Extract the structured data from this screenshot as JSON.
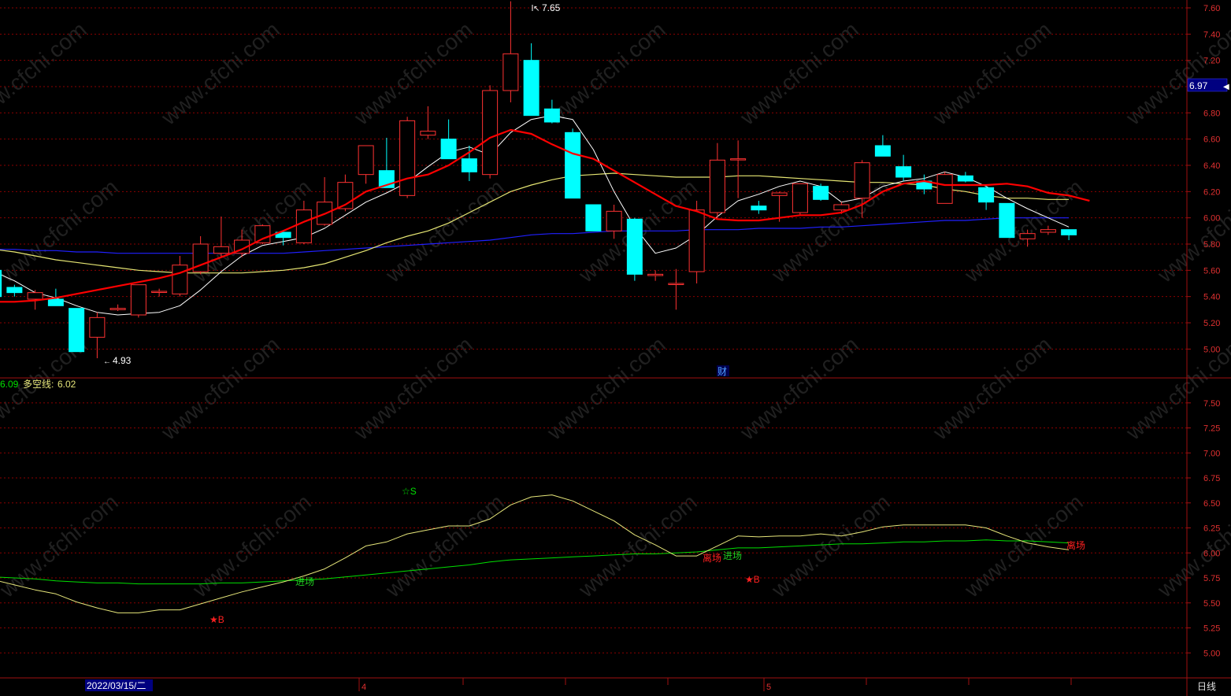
{
  "colors": {
    "background": "#000000",
    "grid": "#8b0000",
    "frame": "#a01010",
    "up": "#ff3232",
    "down": "#00ffff",
    "ma_white": "#ffffff",
    "ma_red": "#ff0000",
    "ma_yellow": "#e6e673",
    "ma_blue": "#2020ff",
    "short_line": "#e6e67a",
    "long_line": "#00e000",
    "axis_text": "#e03030",
    "price_badge_bg": "#000080"
  },
  "top_panel": {
    "y_ticks": [
      "7.60",
      "7.40",
      "7.20",
      "6.80",
      "6.60",
      "6.40",
      "6.20",
      "6.00",
      "5.80",
      "5.60",
      "5.40",
      "5.20",
      "5.00"
    ],
    "current_price": "6.97",
    "high_annotation": "7.65",
    "low_annotation": "4.93",
    "finance_marker": "财"
  },
  "bottom_panel": {
    "header_value1": "6.09",
    "header_label2": "多空线:",
    "header_value2": "6.02",
    "y_ticks": [
      "7.50",
      "7.25",
      "7.00",
      "6.75",
      "6.50",
      "6.25",
      "6.00",
      "5.75",
      "5.50",
      "5.25",
      "5.00"
    ],
    "signals": {
      "sell_star": "☆S",
      "buy_star_1": "★B",
      "buy_star_2": "★B",
      "enter_1": "进场",
      "enter_2": "进场",
      "exit_1": "离场",
      "exit_2": "离场"
    }
  },
  "x_axis": {
    "date_label": "2022/03/15/二",
    "month_4": "4",
    "month_5": "5",
    "period_label": "日线"
  },
  "watermark": "www.cfchi.com",
  "chart_data": {
    "type": "candlestick",
    "top_ylim": [
      4.78,
      7.66
    ],
    "bottom_ylim": [
      4.75,
      7.75
    ],
    "candles": [
      {
        "o": 5.6,
        "h": 5.62,
        "l": 5.4,
        "c": 5.4
      },
      {
        "o": 5.47,
        "h": 5.49,
        "l": 5.4,
        "c": 5.43
      },
      {
        "o": 5.38,
        "h": 5.45,
        "l": 5.3,
        "c": 5.43
      },
      {
        "o": 5.38,
        "h": 5.46,
        "l": 5.33,
        "c": 5.33
      },
      {
        "o": 5.31,
        "h": 5.31,
        "l": 4.98,
        "c": 4.98
      },
      {
        "o": 5.09,
        "h": 5.28,
        "l": 4.93,
        "c": 5.24
      },
      {
        "o": 5.3,
        "h": 5.34,
        "l": 5.29,
        "c": 5.31
      },
      {
        "o": 5.26,
        "h": 5.49,
        "l": 5.24,
        "c": 5.49
      },
      {
        "o": 5.44,
        "h": 5.46,
        "l": 5.4,
        "c": 5.44
      },
      {
        "o": 5.42,
        "h": 5.71,
        "l": 5.4,
        "c": 5.64
      },
      {
        "o": 5.59,
        "h": 5.86,
        "l": 5.57,
        "c": 5.8
      },
      {
        "o": 5.73,
        "h": 6.01,
        "l": 5.7,
        "c": 5.78
      },
      {
        "o": 5.73,
        "h": 5.91,
        "l": 5.7,
        "c": 5.83
      },
      {
        "o": 5.81,
        "h": 5.95,
        "l": 5.8,
        "c": 5.94
      },
      {
        "o": 5.89,
        "h": 5.89,
        "l": 5.79,
        "c": 5.85
      },
      {
        "o": 5.81,
        "h": 6.13,
        "l": 5.8,
        "c": 6.06
      },
      {
        "o": 5.95,
        "h": 6.31,
        "l": 5.94,
        "c": 6.12
      },
      {
        "o": 6.07,
        "h": 6.33,
        "l": 6.05,
        "c": 6.27
      },
      {
        "o": 6.33,
        "h": 6.55,
        "l": 6.26,
        "c": 6.55
      },
      {
        "o": 6.36,
        "h": 6.61,
        "l": 6.23,
        "c": 6.23
      },
      {
        "o": 6.17,
        "h": 6.77,
        "l": 6.15,
        "c": 6.74
      },
      {
        "o": 6.63,
        "h": 6.85,
        "l": 6.6,
        "c": 6.66
      },
      {
        "o": 6.6,
        "h": 6.75,
        "l": 6.45,
        "c": 6.45
      },
      {
        "o": 6.45,
        "h": 6.55,
        "l": 6.28,
        "c": 6.35
      },
      {
        "o": 6.33,
        "h": 7.01,
        "l": 6.3,
        "c": 6.97
      },
      {
        "o": 6.97,
        "h": 7.65,
        "l": 6.88,
        "c": 7.25
      },
      {
        "o": 7.2,
        "h": 7.33,
        "l": 6.78,
        "c": 6.78
      },
      {
        "o": 6.83,
        "h": 6.9,
        "l": 6.72,
        "c": 6.73
      },
      {
        "o": 6.65,
        "h": 6.68,
        "l": 6.45,
        "c": 6.15
      },
      {
        "o": 6.1,
        "h": 6.1,
        "l": 5.9,
        "c": 5.9
      },
      {
        "o": 5.9,
        "h": 6.1,
        "l": 5.84,
        "c": 6.05
      },
      {
        "o": 5.99,
        "h": 6.0,
        "l": 5.52,
        "c": 5.57
      },
      {
        "o": 5.56,
        "h": 5.6,
        "l": 5.52,
        "c": 5.57
      },
      {
        "o": 5.5,
        "h": 5.61,
        "l": 5.3,
        "c": 5.5
      },
      {
        "o": 5.59,
        "h": 6.13,
        "l": 5.5,
        "c": 6.06
      },
      {
        "o": 6.04,
        "h": 6.57,
        "l": 6.0,
        "c": 6.44
      },
      {
        "o": 6.45,
        "h": 6.59,
        "l": 6.15,
        "c": 6.45
      },
      {
        "o": 6.09,
        "h": 6.13,
        "l": 6.03,
        "c": 6.06
      },
      {
        "o": 6.17,
        "h": 6.2,
        "l": 5.97,
        "c": 6.19
      },
      {
        "o": 6.04,
        "h": 6.26,
        "l": 6.02,
        "c": 6.26
      },
      {
        "o": 6.24,
        "h": 6.26,
        "l": 6.13,
        "c": 6.14
      },
      {
        "o": 6.06,
        "h": 6.12,
        "l": 6.03,
        "c": 6.1
      },
      {
        "o": 6.15,
        "h": 6.44,
        "l": 6.0,
        "c": 6.42
      },
      {
        "o": 6.55,
        "h": 6.63,
        "l": 6.48,
        "c": 6.47
      },
      {
        "o": 6.39,
        "h": 6.48,
        "l": 6.28,
        "c": 6.31
      },
      {
        "o": 6.28,
        "h": 6.33,
        "l": 6.18,
        "c": 6.22
      },
      {
        "o": 6.11,
        "h": 6.35,
        "l": 6.11,
        "c": 6.33
      },
      {
        "o": 6.32,
        "h": 6.35,
        "l": 6.27,
        "c": 6.28
      },
      {
        "o": 6.23,
        "h": 6.25,
        "l": 6.06,
        "c": 6.12
      },
      {
        "o": 6.11,
        "h": 6.11,
        "l": 5.85,
        "c": 5.85
      },
      {
        "o": 5.84,
        "h": 5.91,
        "l": 5.78,
        "c": 5.88
      },
      {
        "o": 5.89,
        "h": 5.94,
        "l": 5.87,
        "c": 5.91
      },
      {
        "o": 5.91,
        "h": 5.91,
        "l": 5.83,
        "c": 5.87
      }
    ],
    "ma_white": [
      5.59,
      5.52,
      5.43,
      5.39,
      5.33,
      5.28,
      5.26,
      5.27,
      5.28,
      5.33,
      5.45,
      5.59,
      5.71,
      5.79,
      5.82,
      5.85,
      5.92,
      6.02,
      6.12,
      6.19,
      6.27,
      6.39,
      6.5,
      6.54,
      6.48,
      6.65,
      6.75,
      6.78,
      6.75,
      6.52,
      6.2,
      5.93,
      5.73,
      5.77,
      5.87,
      6.01,
      6.13,
      6.18,
      6.24,
      6.28,
      6.24,
      6.12,
      6.15,
      6.24,
      6.28,
      6.3,
      6.35,
      6.31,
      6.24,
      6.15,
      6.07,
      6.0,
      5.93
    ],
    "ma_red": [
      5.59,
      5.55,
      5.51,
      5.47,
      5.42,
      5.38,
      5.36,
      5.36,
      5.37,
      5.39,
      5.42,
      5.45,
      5.48,
      5.51,
      5.54,
      5.58,
      5.64,
      5.7,
      5.76,
      5.84,
      5.9,
      5.97,
      6.03,
      6.1,
      6.2,
      6.25,
      6.3,
      6.33,
      6.4,
      6.5,
      6.61,
      6.67,
      6.64,
      6.56,
      6.49,
      6.45,
      6.36,
      6.27,
      6.18,
      6.09,
      6.05,
      5.99,
      5.98,
      5.98,
      6.0,
      6.02,
      6.02,
      6.04,
      6.1,
      6.2,
      6.26,
      6.28,
      6.25,
      6.25,
      6.25,
      6.26,
      6.24,
      6.19,
      6.17,
      6.13
    ],
    "ma_yellow": [
      5.76,
      5.74,
      5.71,
      5.68,
      5.66,
      5.64,
      5.62,
      5.6,
      5.59,
      5.58,
      5.58,
      5.58,
      5.58,
      5.59,
      5.6,
      5.62,
      5.65,
      5.7,
      5.75,
      5.81,
      5.86,
      5.9,
      5.96,
      6.04,
      6.12,
      6.2,
      6.25,
      6.29,
      6.32,
      6.33,
      6.34,
      6.33,
      6.32,
      6.31,
      6.31,
      6.31,
      6.32,
      6.32,
      6.31,
      6.3,
      6.29,
      6.28,
      6.27,
      6.27,
      6.26,
      6.25,
      6.22,
      6.2,
      6.17,
      6.15,
      6.15,
      6.14,
      6.14
    ],
    "ma_blue": [
      5.76,
      5.76,
      5.75,
      5.75,
      5.74,
      5.74,
      5.73,
      5.73,
      5.73,
      5.73,
      5.73,
      5.73,
      5.73,
      5.73,
      5.73,
      5.74,
      5.75,
      5.76,
      5.77,
      5.78,
      5.79,
      5.8,
      5.81,
      5.82,
      5.83,
      5.85,
      5.87,
      5.88,
      5.88,
      5.89,
      5.9,
      5.9,
      5.9,
      5.9,
      5.91,
      5.91,
      5.91,
      5.92,
      5.92,
      5.92,
      5.93,
      5.93,
      5.94,
      5.95,
      5.96,
      5.97,
      5.98,
      5.98,
      5.99,
      6.0,
      6.0,
      6.0,
      6.0
    ],
    "short_line": [
      5.73,
      5.68,
      5.63,
      5.59,
      5.51,
      5.45,
      5.4,
      5.4,
      5.43,
      5.43,
      5.49,
      5.55,
      5.61,
      5.66,
      5.71,
      5.77,
      5.84,
      5.95,
      6.07,
      6.11,
      6.19,
      6.23,
      6.27,
      6.27,
      6.34,
      6.48,
      6.56,
      6.58,
      6.52,
      6.42,
      6.32,
      6.18,
      6.08,
      5.97,
      5.97,
      6.07,
      6.17,
      6.16,
      6.17,
      6.17,
      6.19,
      6.17,
      6.21,
      6.26,
      6.28,
      6.28,
      6.28,
      6.28,
      6.25,
      6.17,
      6.1,
      6.06,
      6.03
    ],
    "long_line": [
      5.76,
      5.75,
      5.74,
      5.72,
      5.71,
      5.7,
      5.7,
      5.69,
      5.69,
      5.69,
      5.69,
      5.7,
      5.7,
      5.71,
      5.72,
      5.73,
      5.74,
      5.76,
      5.78,
      5.8,
      5.82,
      5.84,
      5.86,
      5.88,
      5.91,
      5.93,
      5.94,
      5.95,
      5.96,
      5.97,
      5.98,
      5.99,
      5.99,
      6.0,
      6.01,
      6.03,
      6.05,
      6.05,
      6.06,
      6.07,
      6.08,
      6.09,
      6.09,
      6.1,
      6.11,
      6.11,
      6.12,
      6.12,
      6.13,
      6.12,
      6.12,
      6.11,
      6.1
    ]
  }
}
